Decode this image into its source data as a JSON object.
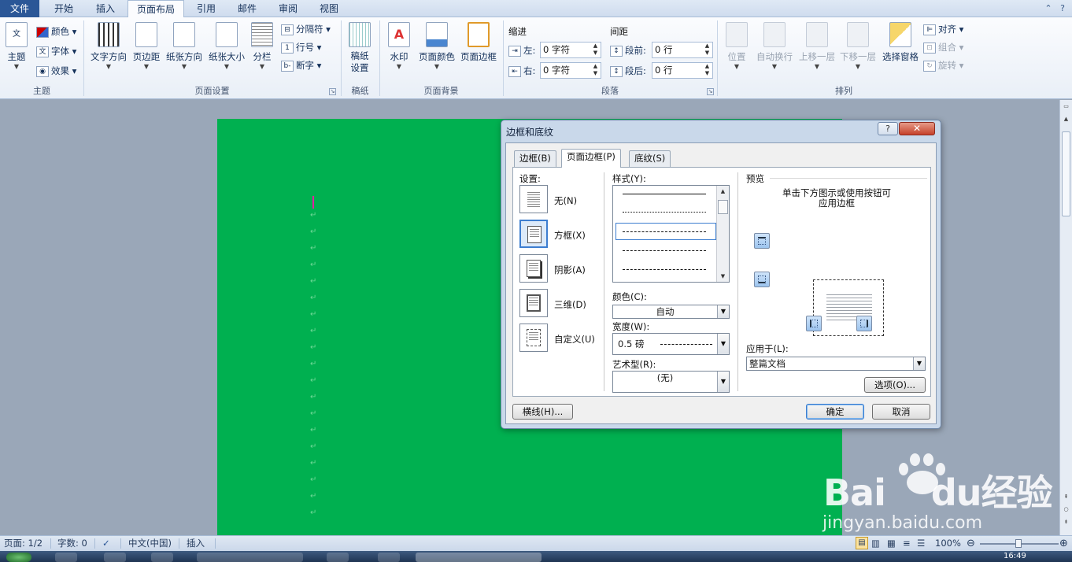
{
  "tabs": [
    "文件",
    "开始",
    "插入",
    "页面布局",
    "引用",
    "邮件",
    "审阅",
    "视图"
  ],
  "ribbon": {
    "theme_group": {
      "label": "主题",
      "theme": "主题",
      "colors": "颜色",
      "fonts": "字体",
      "effects": "效果"
    },
    "page_setup_group": {
      "label": "页面设置",
      "text_direction": "文字方向",
      "margins": "页边距",
      "orientation": "纸张方向",
      "size": "纸张大小",
      "columns": "分栏",
      "breaks": "分隔符",
      "line_numbers": "行号",
      "hyphenation": "断字"
    },
    "draft_group": {
      "label": "稿纸",
      "draft_settings": "稿纸\n设置"
    },
    "background_group": {
      "label": "页面背景",
      "watermark": "水印",
      "page_color": "页面颜色",
      "page_borders": "页面边框"
    },
    "paragraph_group": {
      "label": "段落",
      "indent_title": "缩进",
      "spacing_title": "间距",
      "indent_left_label": "左:",
      "indent_left_value": "0 字符",
      "indent_right_label": "右:",
      "indent_right_value": "0 字符",
      "spacing_before_label": "段前:",
      "spacing_before_value": "0 行",
      "spacing_after_label": "段后:",
      "spacing_after_value": "0 行"
    },
    "arrange_group": {
      "label": "排列",
      "position": "位置",
      "wrap_text": "自动换行",
      "bring_forward": "上移一层",
      "send_backward": "下移一层",
      "selection_pane": "选择窗格",
      "align": "对齐",
      "group": "组合",
      "rotate": "旋转"
    }
  },
  "dialog": {
    "title": "边框和底纹",
    "tabs": [
      "边框(B)",
      "页面边框(P)",
      "底纹(S)"
    ],
    "active_tab": "页面边框(P)",
    "setting_label": "设置:",
    "settings": [
      "无(N)",
      "方框(X)",
      "阴影(A)",
      "三维(D)",
      "自定义(U)"
    ],
    "selected_setting": "方框(X)",
    "style_label": "样式(Y):",
    "color_label": "颜色(C):",
    "color_value": "自动",
    "width_label": "宽度(W):",
    "width_value": "0.5 磅",
    "art_label": "艺术型(R):",
    "art_value": "(无)",
    "preview_label": "预览",
    "preview_hint_1": "单击下方图示或使用按钮可",
    "preview_hint_2": "应用边框",
    "apply_label": "应用于(L):",
    "apply_value": "整篇文档",
    "options_button": "选项(O)...",
    "horizontal_line_button": "横线(H)...",
    "ok_button": "确定",
    "cancel_button": "取消"
  },
  "status": {
    "page": "页面: 1/2",
    "words": "字数: 0",
    "language": "中文(中国)",
    "mode": "插入",
    "zoom": "100%",
    "zoom_level": 1.0
  },
  "watermark": {
    "brand": "Bai",
    "brand2": "du",
    "brand_cn": "经验",
    "url": "jingyan.baidu.com"
  },
  "taskbar": {
    "clock": "16:49"
  },
  "colors": {
    "page_green": "#00b050",
    "file_tab": "#2b5797",
    "close_red": "#c6412a"
  }
}
